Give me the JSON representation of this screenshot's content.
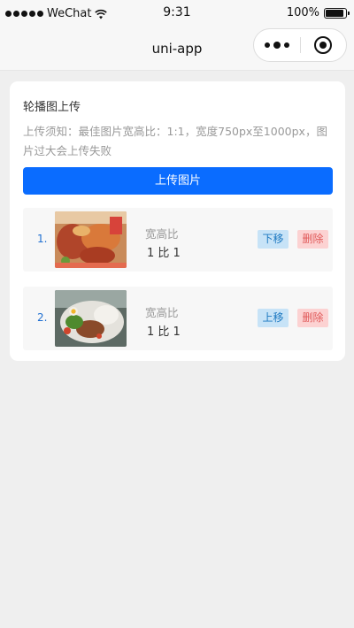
{
  "status_bar": {
    "carrier": "WeChat",
    "time": "9:31",
    "battery": "100%",
    "battery_level": 1.0
  },
  "nav": {
    "title": "uni-app"
  },
  "card": {
    "title": "轮播图上传",
    "notice": "上传须知：最佳图片宽高比：1:1，宽度750px至1000px，图片过大会上传失败",
    "upload_button": "上传图片",
    "items": [
      {
        "index": "1.",
        "ratio_label": "宽高比",
        "ratio_value": "1 比 1",
        "move_label": "下移",
        "delete_label": "删除"
      },
      {
        "index": "2.",
        "ratio_label": "宽高比",
        "ratio_value": "1 比 1",
        "move_label": "上移",
        "delete_label": "删除"
      }
    ]
  },
  "colors": {
    "primary": "#0a6cff",
    "move_bg": "#c7e3f7",
    "move_text": "#1c78c0",
    "delete_bg": "#fcd2d2",
    "delete_text": "#e05a5a",
    "page_bg": "#efefef"
  }
}
